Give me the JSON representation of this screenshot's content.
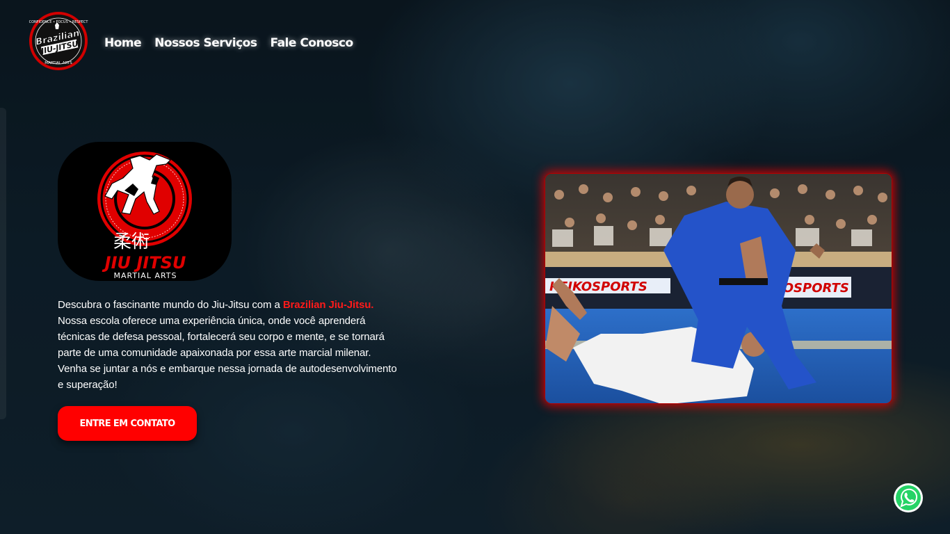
{
  "header": {
    "logo": {
      "top_text": "CONFIDENCE • FOCUS • RESPECT",
      "line1": "Brazilian",
      "line2": "JIU-JITSU",
      "bottom_text": "MARTIAL ARTS"
    },
    "nav": [
      {
        "label": "Home"
      },
      {
        "label": "Nossos Serviços"
      },
      {
        "label": "Fale Conosco"
      }
    ]
  },
  "hero": {
    "badge": {
      "kanji": "柔術",
      "title": "JIU JITSU",
      "subtitle": "MARTIAL ARTS"
    },
    "intro_before": "Descubra o fascinante mundo do Jiu-Jitsu com a ",
    "brand": "Brazilian Jiu-Jitsu.",
    "intro_after": " Nossa escola oferece uma experiência única, onde você aprenderá técnicas de defesa pessoal, fortalecerá seu corpo e mente, e se tornará parte de uma comunidade apaixonada por essa arte marcial milenar. Venha se juntar a nós e embarque nessa jornada de autodesenvolvimento e superação!",
    "cta_label": "ENTRE EM CONTATO"
  },
  "photo": {
    "banner_left": "KEIKOSPORTS",
    "banner_right": "KEIKOSPORTS"
  },
  "colors": {
    "accent": "#ff0000",
    "background": "#0b1a24",
    "photo_mat": "#1f5fbf"
  },
  "icons": {
    "floating": "whatsapp-icon"
  }
}
